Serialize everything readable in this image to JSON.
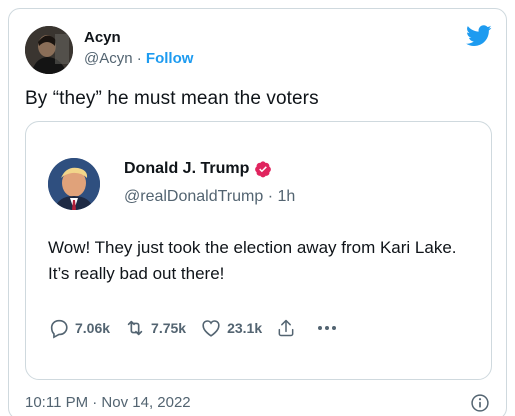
{
  "tweet": {
    "author_name": "Acyn",
    "author_handle": "@Acyn",
    "separator": "·",
    "follow_label": "Follow",
    "text": "By “they” he must mean the voters",
    "timestamp": "10:11 PM · Nov 14, 2022"
  },
  "quote": {
    "author_name": "Donald J. Trump",
    "author_handle": "@realDonaldTrump",
    "time_ago": "1h",
    "text": "Wow! They just took the election away from Kari Lake. It’s really bad out there!",
    "replies": "7.06k",
    "retweets": "7.75k",
    "likes": "23.1k"
  },
  "icons": {
    "brand": "twitter-logo-icon",
    "verified": "verified-badge-icon",
    "reply": "reply-icon",
    "retweet": "retweet-icon",
    "like": "heart-icon",
    "share": "share-icon",
    "more": "more-icon",
    "info": "info-icon"
  },
  "colors": {
    "brand_blue": "#1d9bf0",
    "text_primary": "#0f1419",
    "text_secondary": "#536471",
    "border": "#cfd9de",
    "verified_badge": "#e0245e"
  }
}
